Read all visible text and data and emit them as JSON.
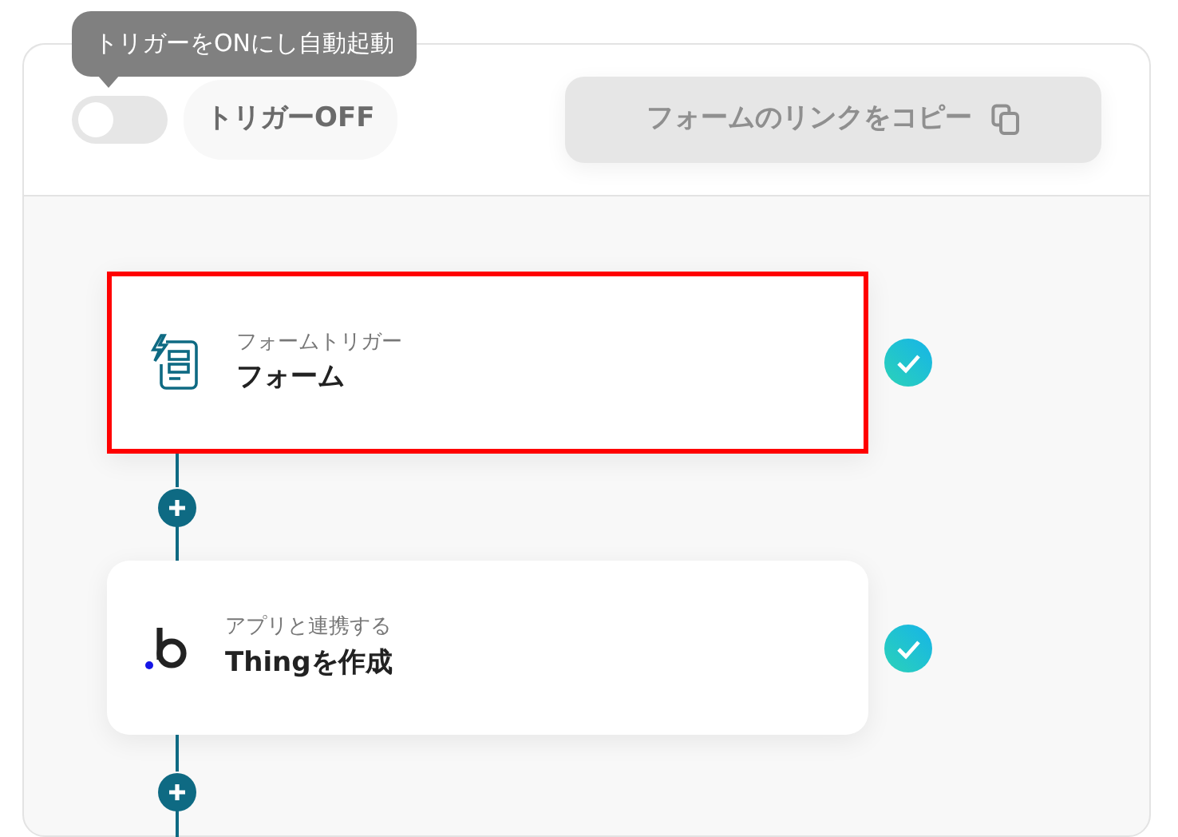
{
  "tooltip": {
    "text": "トリガーをONにし自動起動"
  },
  "trigger": {
    "on": false,
    "label": "トリガーOFF"
  },
  "copy_button": {
    "label": "フォームのリンクをコピー",
    "disabled": true
  },
  "steps": [
    {
      "kind": "form",
      "caption": "フォームトリガー",
      "title": "フォーム",
      "highlighted": true,
      "done": true
    },
    {
      "kind": "app",
      "caption": "アプリと連携する",
      "title": "Thingを作成",
      "highlighted": false,
      "done": true
    }
  ]
}
